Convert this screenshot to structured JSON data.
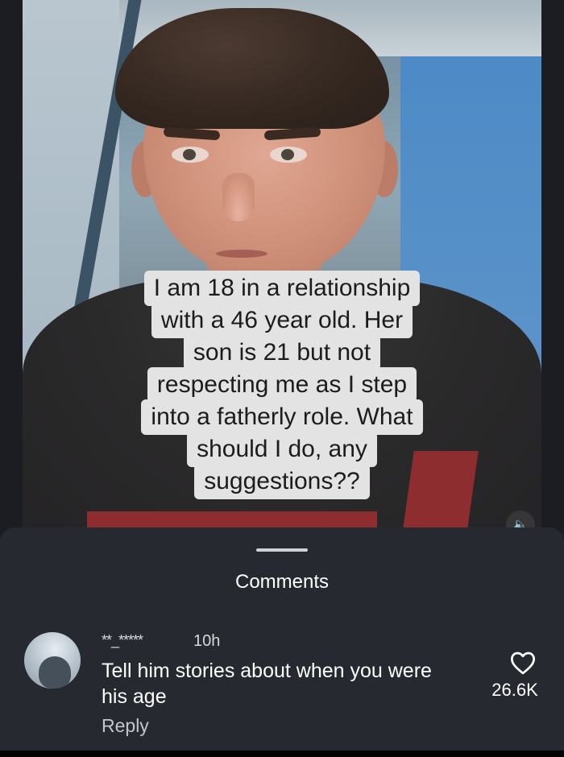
{
  "video": {
    "caption_lines": [
      "I am 18 in a relationship",
      "with a 46 year old. Her",
      "son is 21 but not",
      "respecting me as I step",
      "into a fatherly role. What",
      "should I do, any",
      "suggestions??"
    ],
    "mute_icon": "speaker-mute-icon"
  },
  "comments_sheet": {
    "title": "Comments",
    "comment": {
      "username": "**_*****",
      "time": "10h",
      "text": "Tell him stories about when you were his age",
      "reply_label": "Reply",
      "like_count": "26.6K",
      "like_icon": "heart-outline-icon"
    }
  }
}
